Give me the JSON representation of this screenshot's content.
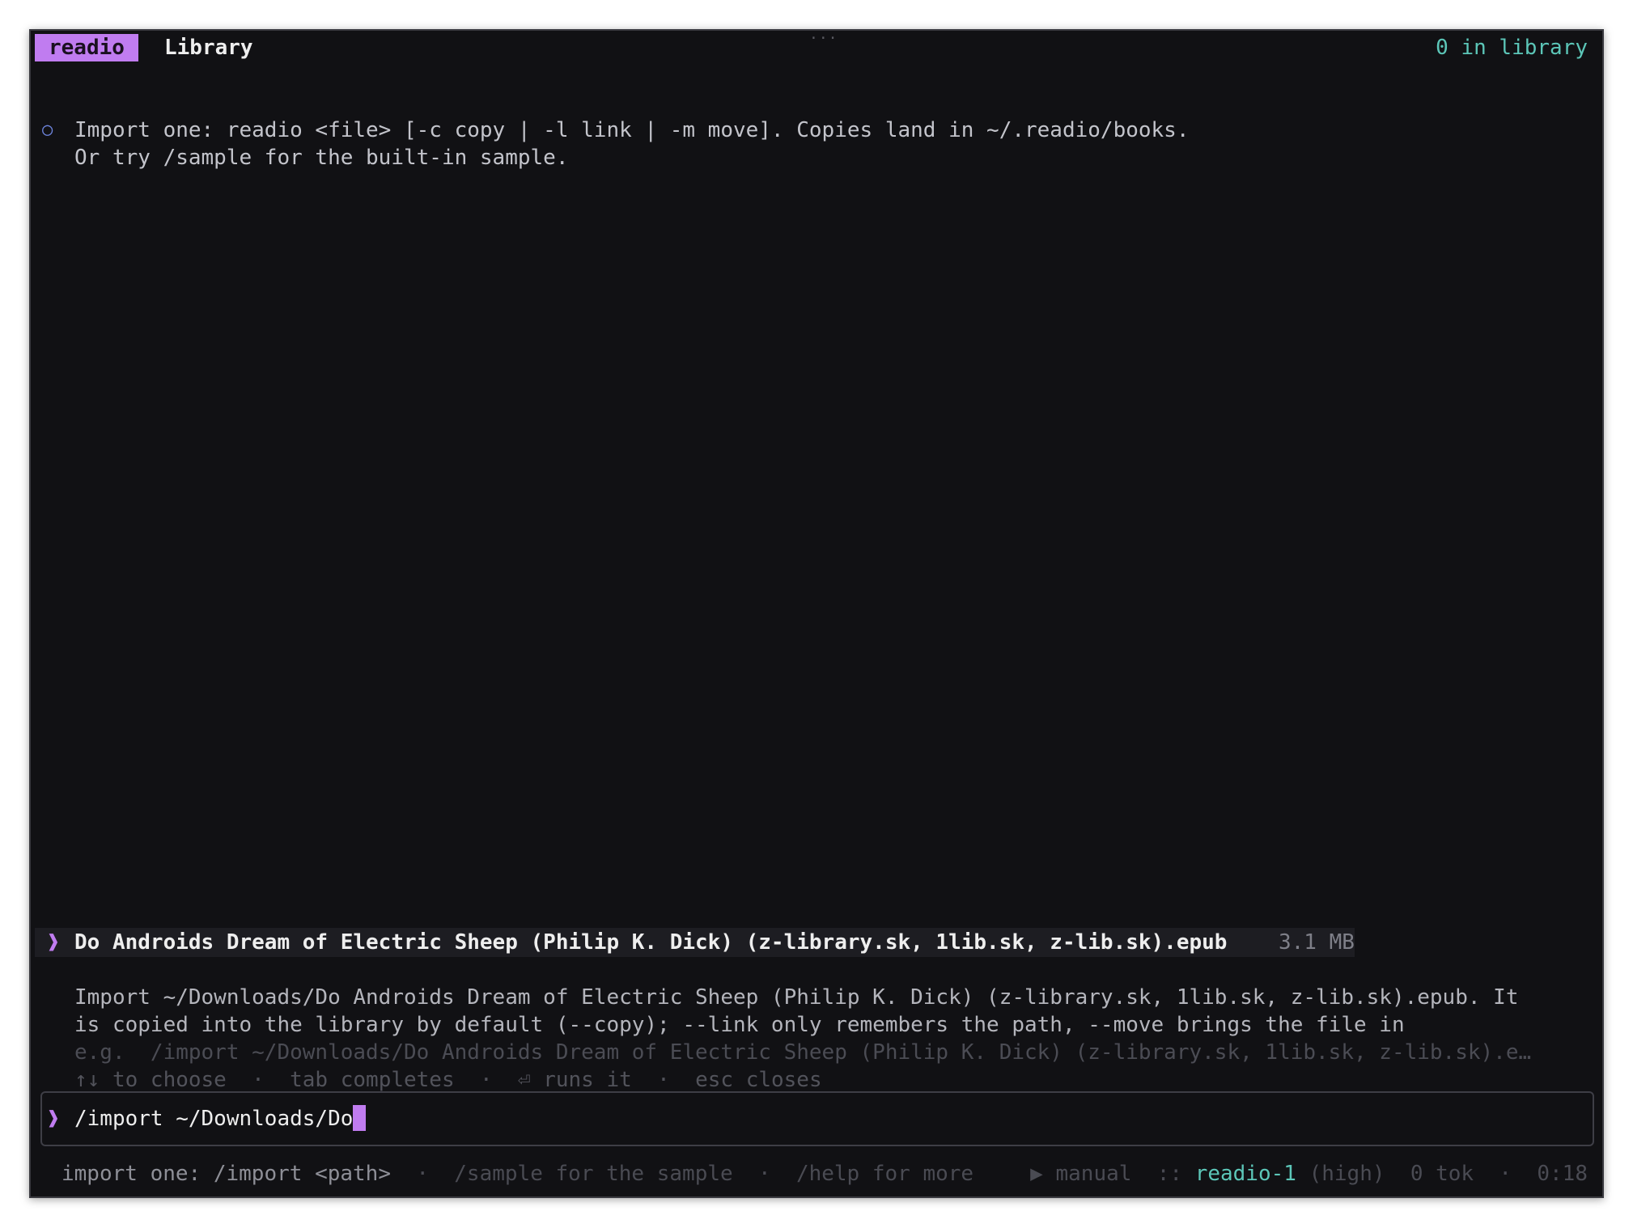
{
  "header": {
    "brand": "readio",
    "title": "Library",
    "library_count": "0 in library"
  },
  "info": {
    "line1": "Import one: readio <file> [-c copy | -l link | -m move]. Copies land in ~/.readio/books.",
    "line2": "Or try /sample for the built-in sample."
  },
  "completion": {
    "caret": "❱",
    "filename": "Do Androids Dream of Electric Sheep (Philip K. Dick) (z-library.sk, 1lib.sk, z-lib.sk).epub",
    "size": "3.1 MB",
    "description_line1": "Import ~/Downloads/Do Androids Dream of Electric Sheep (Philip K. Dick) (z-library.sk, 1lib.sk, z-lib.sk).epub. It",
    "description_line2": "is copied into the library by default (--copy); --link only remembers the path, --move brings the file in",
    "example": "e.g.  /import ~/Downloads/Do Androids Dream of Electric Sheep (Philip K. Dick) (z-library.sk, 1lib.sk, z-lib.sk).e…",
    "hints": {
      "choose": "↑↓ to choose",
      "complete": "tab completes",
      "run": "⏎ runs it",
      "close": "esc closes",
      "separator": "·"
    }
  },
  "input": {
    "prompt": "❱",
    "value": "/import ~/Downloads/Do"
  },
  "status": {
    "import_hint": "import one: /import <path>",
    "sample_hint": "/sample for the sample",
    "help_hint": "/help for more",
    "separator": "·",
    "mode_icon": "▶",
    "mode": "manual",
    "model_sep": "::",
    "model": "readio-1",
    "effort": "(high)",
    "tokens": "0 tok",
    "elapsed": "0:18"
  },
  "colors": {
    "accent": "#c07cf0",
    "teal": "#5cc6b8",
    "background": "#111114"
  }
}
